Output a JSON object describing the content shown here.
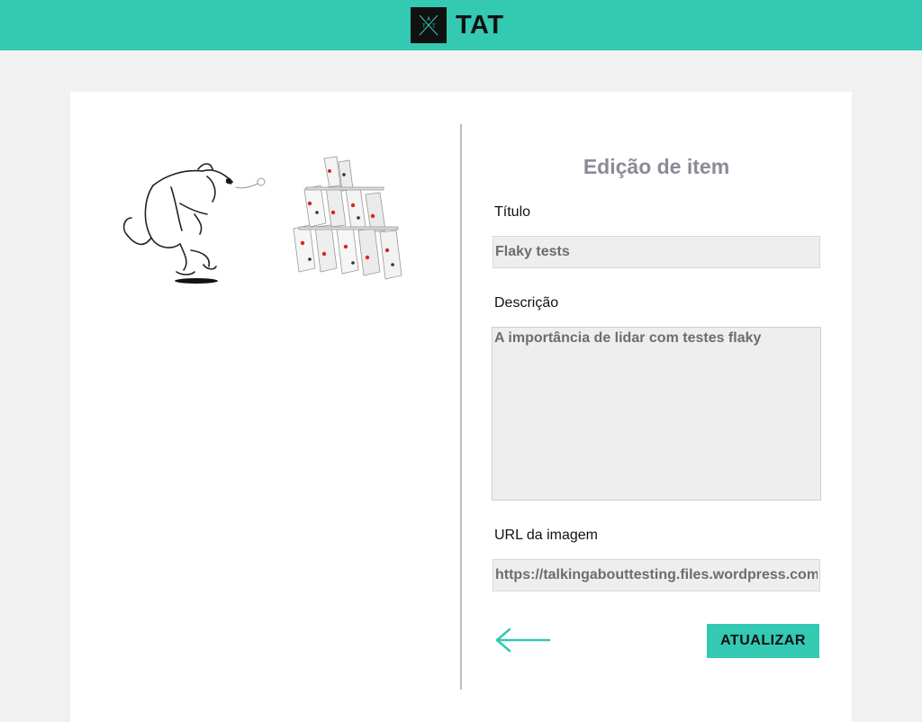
{
  "header": {
    "brand_name": "TAT",
    "logo_letters": [
      "T",
      "A",
      "T"
    ],
    "background": "#33c9b3"
  },
  "item_image": {
    "description_icon": "dog-and-house-of-cards-illustration"
  },
  "form": {
    "title": "Edição de item",
    "title_label": "Título",
    "title_value": "Flaky tests",
    "description_label": "Descrição",
    "description_value": "A importância de lidar com testes flaky",
    "image_url_label": "URL da imagem",
    "image_url_value": "https://talkingabouttesting.files.wordpress.com",
    "back_icon": "arrow-left-icon",
    "update_label": "ATUALIZAR"
  },
  "colors": {
    "accent": "#33c9b3",
    "page_bg": "#f1f1f1",
    "field_bg": "#eeeeee",
    "title_color": "#8b8b96"
  }
}
